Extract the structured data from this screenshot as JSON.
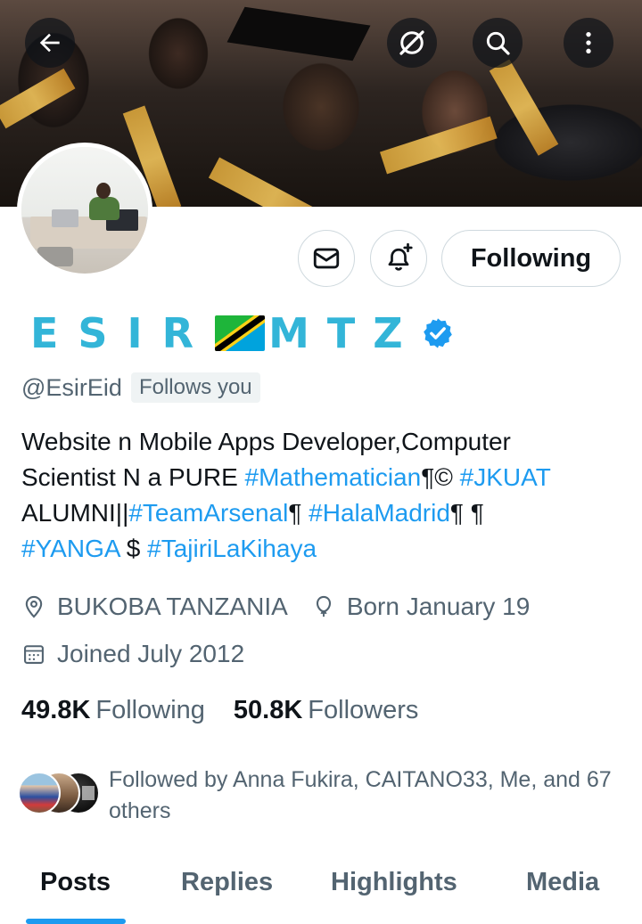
{
  "profile": {
    "name_part1": "ESIR",
    "name_part2": "MTZ",
    "handle": "@EsirEid",
    "follows_you": "Follows you",
    "bio": {
      "line1": "Website n Mobile Apps Developer,Computer",
      "line2_prefix": "Scientist N a PURE ",
      "tag_mathematician": "#Mathematician",
      "line2_mid": "¶© ",
      "tag_jkuat": "#JKUAT",
      "line3_prefix": "ALUMNI||",
      "tag_arsenal": "#TeamArsenal",
      "line3_mid": "¶ ",
      "tag_halamadrid": "#HalaMadrid",
      "line3_suffix": "¶ ¶",
      "tag_yanga": "#YANGA",
      "line4_mid": " $ ",
      "tag_tajiri": "#TajiriLaKihaya"
    },
    "location": "BUKOBA TANZANIA",
    "birthday": "Born January 19",
    "joined": "Joined July 2012",
    "following_count": "49.8K",
    "following_label": "Following",
    "followers_count": "50.8K",
    "followers_label": "Followers",
    "followed_by": "Followed by Anna Fukira, CAITANO33, Me, and 67 others"
  },
  "actions": {
    "following_button": "Following"
  },
  "tabs": [
    {
      "label": "Posts",
      "active": true
    },
    {
      "label": "Replies",
      "active": false
    },
    {
      "label": "Highlights",
      "active": false
    },
    {
      "label": "Media",
      "active": false
    }
  ],
  "colors": {
    "accent": "#1d9bf0",
    "name": "#33b5d8",
    "muted": "#536471",
    "text": "#0f1419",
    "border": "#cfd9de"
  },
  "icons": {
    "back": "arrow-left-icon",
    "grok": "grok-icon",
    "search": "search-icon",
    "more": "more-vertical-icon",
    "message": "envelope-icon",
    "notify": "bell-plus-icon",
    "verified": "verified-badge-icon",
    "flag": "tanzania-flag-icon",
    "location": "location-pin-icon",
    "birthday": "balloon-icon",
    "joined": "calendar-icon"
  }
}
